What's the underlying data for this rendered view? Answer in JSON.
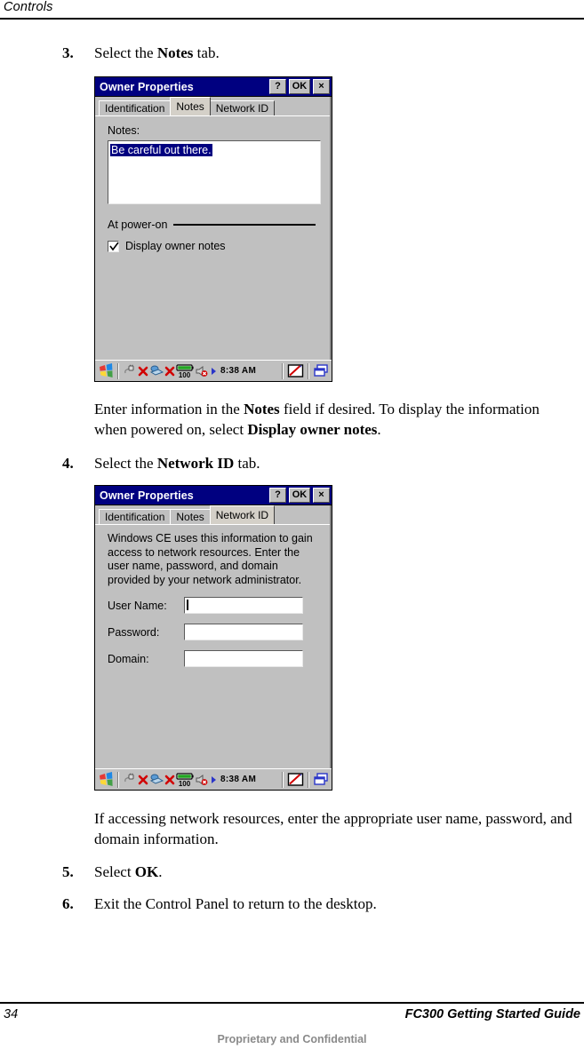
{
  "header": {
    "chapter_title": "Controls"
  },
  "steps": [
    {
      "number": "3.",
      "text_before": "Select the ",
      "bold": "Notes",
      "text_after": " tab."
    },
    {
      "number": "4.",
      "text_before": "Select the ",
      "bold": "Network ID",
      "text_after": " tab."
    },
    {
      "number": "5.",
      "text_before": "Select ",
      "bold": "OK",
      "text_after": "."
    },
    {
      "number": "6.",
      "text_before": "Exit the Control Panel to return to the desktop.",
      "bold": "",
      "text_after": ""
    }
  ],
  "paragraphs": {
    "after_notes_1": "Enter information in the ",
    "after_notes_bold1": "Notes",
    "after_notes_2": " field if desired. To display the information when powered on, select ",
    "after_notes_bold2": "Display owner notes",
    "after_notes_3": ".",
    "after_network": "If accessing network resources, enter the appropriate user name, password, and domain information."
  },
  "dialog_notes": {
    "title": "Owner Properties",
    "buttons": {
      "help": "?",
      "ok": "OK",
      "close": "×"
    },
    "tabs": [
      {
        "label": "Identification",
        "active": false
      },
      {
        "label": "Notes",
        "active": true
      },
      {
        "label": "Network ID",
        "active": false
      }
    ],
    "notes_label": "Notes:",
    "notes_value": "Be careful out there.",
    "group_label": "At power-on",
    "checkbox_label": "Display owner notes",
    "checkbox_checked": true
  },
  "dialog_network": {
    "title": "Owner Properties",
    "buttons": {
      "help": "?",
      "ok": "OK",
      "close": "×"
    },
    "tabs": [
      {
        "label": "Identification",
        "active": false
      },
      {
        "label": "Notes",
        "active": false
      },
      {
        "label": "Network ID",
        "active": true
      }
    ],
    "description": "Windows CE uses this information to gain access to network resources. Enter the user name, password, and domain provided by your network administrator.",
    "fields": [
      {
        "label": "User Name:",
        "value": "",
        "focused": true
      },
      {
        "label": "Password:",
        "value": "",
        "focused": false
      },
      {
        "label": "Domain:",
        "value": "",
        "focused": false
      }
    ]
  },
  "taskbar": {
    "start_icon": "windows-start-icon",
    "tray_icons": [
      "ac-power-disconnected-icon",
      "network-disconnected-icon",
      "battery-icon",
      "speaker-muted-icon",
      "playback-arrow-icon"
    ],
    "battery_level": "100",
    "time": "8:38 AM",
    "right_icons": [
      "input-panel-pen-icon",
      "desktop-windows-icon"
    ]
  },
  "footer": {
    "page_number": "34",
    "guide_title": "FC300  Getting Started Guide",
    "confidential": "Proprietary and Confidential"
  },
  "colors": {
    "titlebar": "#000080",
    "face": "#c0c0c0",
    "selection": "#000080",
    "footer_gray": "#8a8a8a"
  }
}
